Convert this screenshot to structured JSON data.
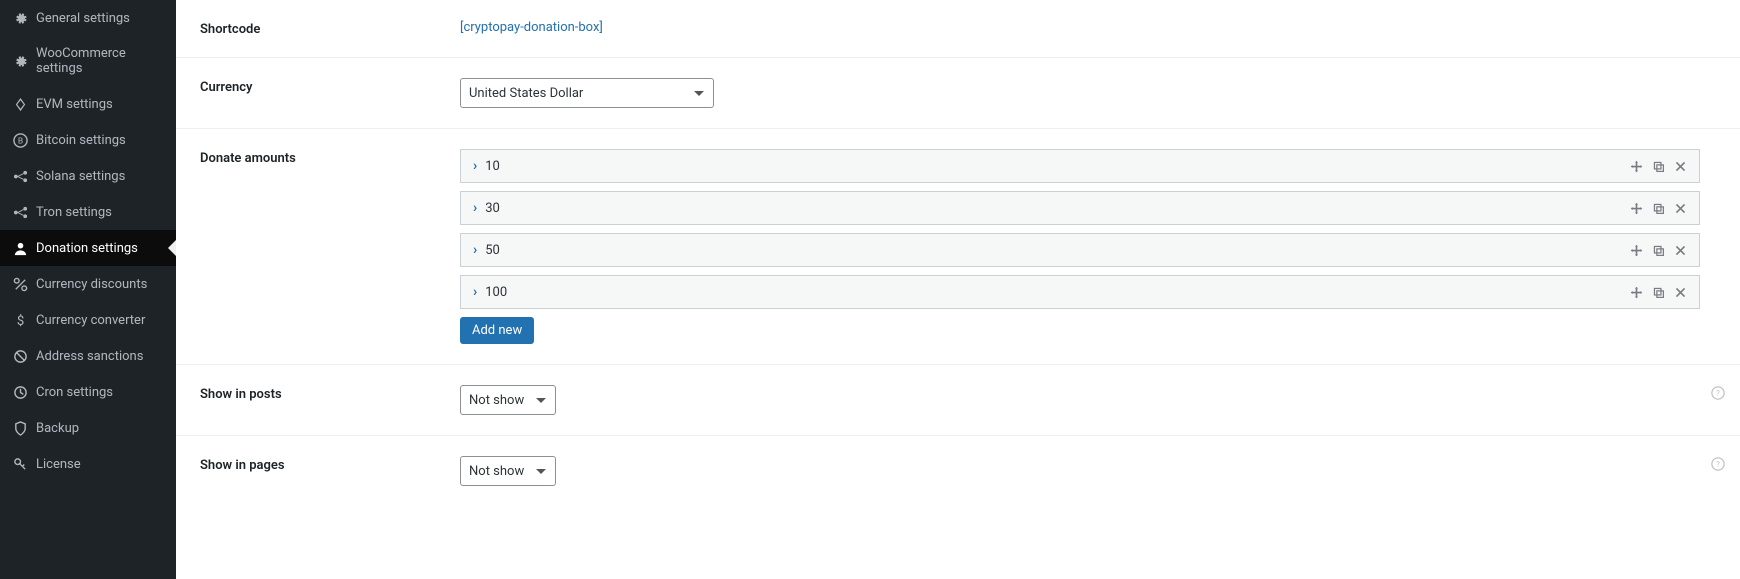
{
  "sidebar": {
    "items": [
      {
        "icon": "gear",
        "label": "General settings",
        "active": false
      },
      {
        "icon": "gear",
        "label": "WooCommerce settings",
        "active": false
      },
      {
        "icon": "diamond",
        "label": "EVM settings",
        "active": false
      },
      {
        "icon": "bitcoin",
        "label": "Bitcoin settings",
        "active": false
      },
      {
        "icon": "network",
        "label": "Solana settings",
        "active": false
      },
      {
        "icon": "network",
        "label": "Tron settings",
        "active": false
      },
      {
        "icon": "donation",
        "label": "Donation settings",
        "active": true
      },
      {
        "icon": "percent",
        "label": "Currency discounts",
        "active": false
      },
      {
        "icon": "dollar",
        "label": "Currency converter",
        "active": false
      },
      {
        "icon": "ban",
        "label": "Address sanctions",
        "active": false
      },
      {
        "icon": "clock",
        "label": "Cron settings",
        "active": false
      },
      {
        "icon": "shield",
        "label": "Backup",
        "active": false
      },
      {
        "icon": "key",
        "label": "License",
        "active": false
      }
    ]
  },
  "form": {
    "shortcode": {
      "label": "Shortcode",
      "value": "[cryptopay-donation-box]"
    },
    "currency": {
      "label": "Currency",
      "selected": "United States Dollar"
    },
    "donate_amounts": {
      "label": "Donate amounts",
      "values": [
        "10",
        "30",
        "50",
        "100"
      ],
      "add_button": "Add new"
    },
    "show_in_posts": {
      "label": "Show in posts",
      "selected": "Not show"
    },
    "show_in_pages": {
      "label": "Show in pages",
      "selected": "Not show"
    }
  }
}
